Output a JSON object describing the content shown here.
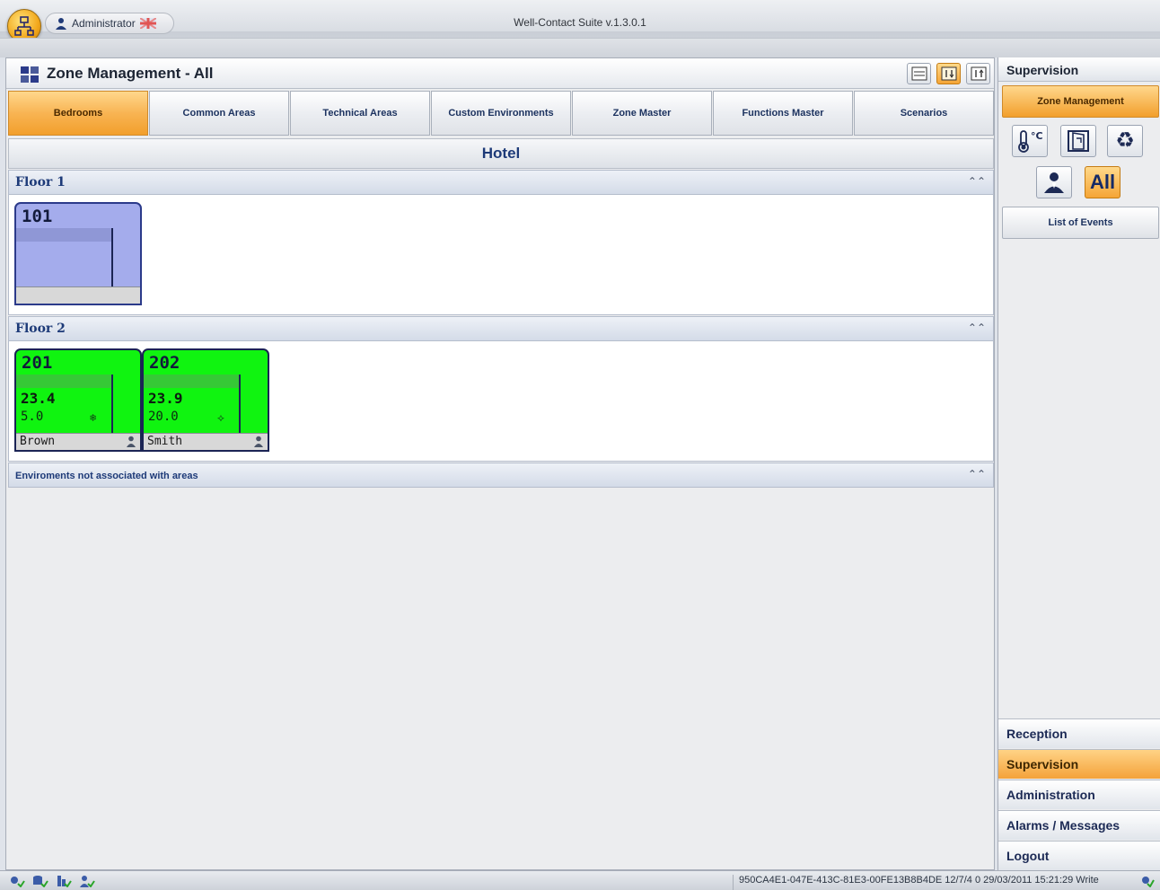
{
  "window": {
    "title": "Well-Contact Suite v.1.3.0.1",
    "user": "Administrator"
  },
  "zone": {
    "title": "Zone Management - All",
    "tabs": [
      {
        "label": "Bedrooms",
        "active": true
      },
      {
        "label": "Common Areas"
      },
      {
        "label": "Technical Areas"
      },
      {
        "label": "Custom Environments"
      },
      {
        "label": "Zone Master"
      },
      {
        "label": "Functions Master"
      },
      {
        "label": "Scenarios"
      }
    ],
    "area": "Hotel",
    "groups": [
      {
        "label": "Floor 1",
        "rooms": [
          {
            "number": "101"
          }
        ]
      },
      {
        "label": "Floor 2",
        "rooms": [
          {
            "number": "201",
            "temperature": "23.4",
            "setpoint": "5.0",
            "guest": "Brown"
          },
          {
            "number": "202",
            "temperature": "23.9",
            "setpoint": "20.0",
            "guest": "Smith"
          }
        ]
      },
      {
        "label": "Enviroments not associated with areas"
      }
    ]
  },
  "sidebar": {
    "title": "Supervision",
    "zone_management": "Zone Management",
    "filter_all": "All",
    "list_of_events": "List of Events",
    "nav": [
      {
        "label": "Reception"
      },
      {
        "label": "Supervision",
        "active": true
      },
      {
        "label": "Administration"
      },
      {
        "label": "Alarms / Messages"
      },
      {
        "label": "Logout"
      }
    ]
  },
  "status": {
    "text": "950CA4E1-047E-413C-81E3-00FE13B8B4DE 12/7/4 0 29/03/2011 15:21:29 Write"
  },
  "colors": {
    "accent": "#f5a536",
    "room_blue": "#a4acec",
    "room_green": "#10f410"
  }
}
